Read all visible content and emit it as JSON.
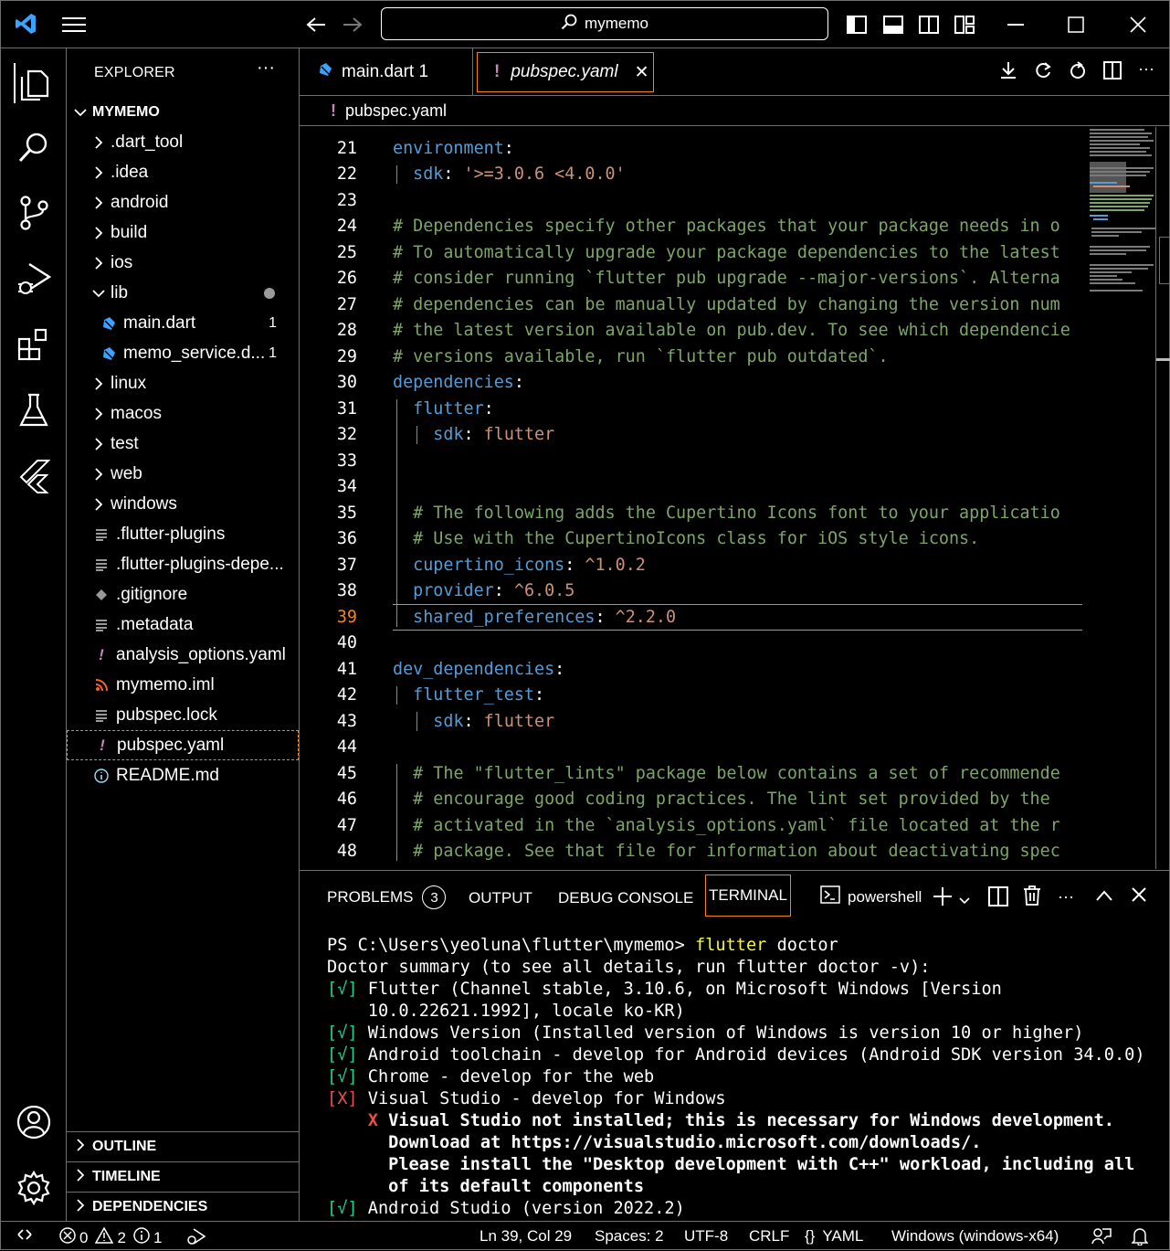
{
  "titlebar": {
    "search_text": "mymemo"
  },
  "activity": [
    "explorer-icon",
    "search-icon",
    "source-control-icon",
    "run-debug-icon",
    "extensions-icon",
    "testing-icon",
    "flutter-icon",
    "account-icon",
    "settings-gear-icon"
  ],
  "sidebar": {
    "title": "EXPLORER",
    "more": "···",
    "project": "MYMEMO",
    "items": [
      {
        "label": ".dart_tool"
      },
      {
        "label": ".idea"
      },
      {
        "label": "android"
      },
      {
        "label": "build"
      },
      {
        "label": "ios"
      },
      {
        "label": "lib"
      },
      {
        "label": "main.dart",
        "badge": "1"
      },
      {
        "label": "memo_service.d...",
        "badge": "1"
      },
      {
        "label": "linux"
      },
      {
        "label": "macos"
      },
      {
        "label": "test"
      },
      {
        "label": "web"
      },
      {
        "label": "windows"
      },
      {
        "label": ".flutter-plugins"
      },
      {
        "label": ".flutter-plugins-depe..."
      },
      {
        "label": ".gitignore"
      },
      {
        "label": ".metadata"
      },
      {
        "label": "analysis_options.yaml"
      },
      {
        "label": "mymemo.iml"
      },
      {
        "label": "pubspec.lock"
      },
      {
        "label": "pubspec.yaml"
      },
      {
        "label": "README.md"
      }
    ],
    "panels": [
      "OUTLINE",
      "TIMELINE",
      "DEPENDENCIES"
    ]
  },
  "tabs": [
    {
      "label": "main.dart 1"
    },
    {
      "label": "pubspec.yaml",
      "close": "✕"
    }
  ],
  "breadcrumb": "pubspec.yaml",
  "code": {
    "lines": [
      {
        "n": "21",
        "parts": [
          [
            "k",
            "environment"
          ],
          [
            "w",
            ":"
          ]
        ]
      },
      {
        "n": "22",
        "parts": [
          [
            "w",
            "  "
          ],
          [
            "k",
            "sdk"
          ],
          [
            "w",
            ": "
          ],
          [
            "s",
            "'>=3.0.6 <4.0.0'"
          ]
        ]
      },
      {
        "n": "23",
        "parts": []
      },
      {
        "n": "24",
        "parts": [
          [
            "c",
            "# Dependencies specify other packages that your package needs in o"
          ]
        ]
      },
      {
        "n": "25",
        "parts": [
          [
            "c",
            "# To automatically upgrade your package dependencies to the latest"
          ]
        ]
      },
      {
        "n": "26",
        "parts": [
          [
            "c",
            "# consider running `flutter pub upgrade --major-versions`. Alterna"
          ]
        ]
      },
      {
        "n": "27",
        "parts": [
          [
            "c",
            "# dependencies can be manually updated by changing the version num"
          ]
        ]
      },
      {
        "n": "28",
        "parts": [
          [
            "c",
            "# the latest version available on pub.dev. To see which dependencie"
          ]
        ]
      },
      {
        "n": "29",
        "parts": [
          [
            "c",
            "# versions available, run `flutter pub outdated`."
          ]
        ]
      },
      {
        "n": "30",
        "parts": [
          [
            "k",
            "dependencies"
          ],
          [
            "w",
            ":"
          ]
        ]
      },
      {
        "n": "31",
        "parts": [
          [
            "w",
            "  "
          ],
          [
            "k",
            "flutter"
          ],
          [
            "w",
            ":"
          ]
        ]
      },
      {
        "n": "32",
        "parts": [
          [
            "w",
            "    "
          ],
          [
            "k",
            "sdk"
          ],
          [
            "w",
            ": "
          ],
          [
            "s",
            "flutter"
          ]
        ]
      },
      {
        "n": "33",
        "parts": []
      },
      {
        "n": "34",
        "parts": []
      },
      {
        "n": "35",
        "parts": [
          [
            "w",
            "  "
          ],
          [
            "c",
            "# The following adds the Cupertino Icons font to your applicatio"
          ]
        ]
      },
      {
        "n": "36",
        "parts": [
          [
            "w",
            "  "
          ],
          [
            "c",
            "# Use with the CupertinoIcons class for iOS style icons."
          ]
        ]
      },
      {
        "n": "37",
        "parts": [
          [
            "w",
            "  "
          ],
          [
            "k",
            "cupertino_icons"
          ],
          [
            "w",
            ": "
          ],
          [
            "s",
            "^1.0.2"
          ]
        ]
      },
      {
        "n": "38",
        "parts": [
          [
            "w",
            "  "
          ],
          [
            "k",
            "provider"
          ],
          [
            "w",
            ": "
          ],
          [
            "s",
            "^6.0.5"
          ]
        ]
      },
      {
        "n": "39",
        "parts": [
          [
            "w",
            "  "
          ],
          [
            "k",
            "shared_preferences"
          ],
          [
            "w",
            ": "
          ],
          [
            "s",
            "^2.2.0"
          ]
        ]
      },
      {
        "n": "40",
        "parts": []
      },
      {
        "n": "41",
        "parts": [
          [
            "k",
            "dev_dependencies"
          ],
          [
            "w",
            ":"
          ]
        ]
      },
      {
        "n": "42",
        "parts": [
          [
            "w",
            "  "
          ],
          [
            "k",
            "flutter_test"
          ],
          [
            "w",
            ":"
          ]
        ]
      },
      {
        "n": "43",
        "parts": [
          [
            "w",
            "    "
          ],
          [
            "k",
            "sdk"
          ],
          [
            "w",
            ": "
          ],
          [
            "s",
            "flutter"
          ]
        ]
      },
      {
        "n": "44",
        "parts": []
      },
      {
        "n": "45",
        "parts": [
          [
            "w",
            "  "
          ],
          [
            "c",
            "# The \"flutter_lints\" package below contains a set of recommende"
          ]
        ]
      },
      {
        "n": "46",
        "parts": [
          [
            "w",
            "  "
          ],
          [
            "c",
            "# encourage good coding practices. The lint set provided by the"
          ]
        ]
      },
      {
        "n": "47",
        "parts": [
          [
            "w",
            "  "
          ],
          [
            "c",
            "# activated in the `analysis_options.yaml` file located at the r"
          ]
        ]
      },
      {
        "n": "48",
        "parts": [
          [
            "w",
            "  "
          ],
          [
            "c",
            "# package. See that file for information about deactivating spec"
          ]
        ]
      }
    ]
  },
  "panel": {
    "tabs": {
      "problems": "PROBLEMS",
      "problems_count": "3",
      "output": "OUTPUT",
      "debug": "DEBUG CONSOLE",
      "terminal": "TERMINAL"
    },
    "shell": "powershell",
    "terminal": [
      {
        "parts": [
          [
            "w",
            "PS C:\\Users\\yeoluna\\flutter\\mymemo> "
          ],
          [
            "y",
            "flutter"
          ],
          [
            "w",
            " doctor"
          ]
        ]
      },
      {
        "parts": [
          [
            "w",
            "Doctor summary (to see all details, run flutter doctor -v):"
          ]
        ]
      },
      {
        "parts": [
          [
            "g",
            "[√]"
          ],
          [
            "w",
            " Flutter (Channel stable, 3.10.6, on Microsoft Windows [Version"
          ]
        ]
      },
      {
        "parts": [
          [
            "w",
            "    10.0.22621.1992], locale ko-KR)"
          ]
        ]
      },
      {
        "parts": [
          [
            "g",
            "[√]"
          ],
          [
            "w",
            " Windows Version (Installed version of Windows is version 10 or higher)"
          ]
        ]
      },
      {
        "parts": [
          [
            "g",
            "[√]"
          ],
          [
            "w",
            " Android toolchain - develop for Android devices (Android SDK version 34.0.0)"
          ]
        ]
      },
      {
        "parts": [
          [
            "g",
            "[√]"
          ],
          [
            "w",
            " Chrome - develop for the web"
          ]
        ]
      },
      {
        "parts": [
          [
            "r",
            "[X]"
          ],
          [
            "w",
            " Visual Studio - develop for Windows"
          ]
        ]
      },
      {
        "parts": [
          [
            "w",
            "    "
          ],
          [
            "rb",
            "X"
          ],
          [
            "b",
            " Visual Studio not installed; this is necessary for Windows development."
          ]
        ]
      },
      {
        "parts": [
          [
            "b",
            "      Download at https://visualstudio.microsoft.com/downloads/."
          ]
        ]
      },
      {
        "parts": [
          [
            "b",
            "      Please install the \"Desktop development with C++\" workload, including all"
          ]
        ]
      },
      {
        "parts": [
          [
            "b",
            "      of its default components"
          ]
        ]
      },
      {
        "parts": [
          [
            "g",
            "[√]"
          ],
          [
            "w",
            " Android Studio (version 2022.2)"
          ]
        ]
      }
    ]
  },
  "status": {
    "errors": "0",
    "warnings": "2",
    "info": "1",
    "position": "Ln 39, Col 29",
    "spaces": "Spaces: 2",
    "encoding": "UTF-8",
    "eol": "CRLF",
    "language": "YAML",
    "platform": "Windows (windows-x64)"
  }
}
